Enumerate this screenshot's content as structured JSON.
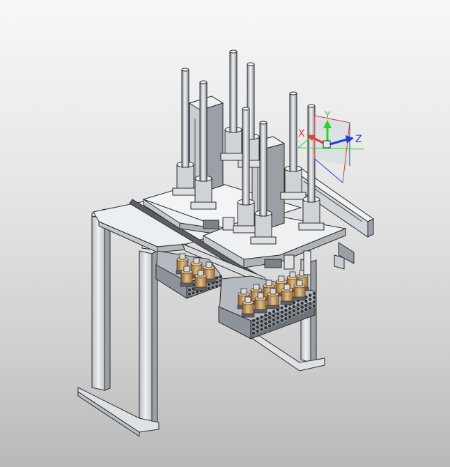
{
  "viewport": {
    "background_top": "#f7f7f7",
    "background_bottom": "#b9b9b9"
  },
  "triad": {
    "x_label": "X",
    "y_label": "Y",
    "z_label": "Z",
    "x_color": "#e53935",
    "y_color": "#2bd22b",
    "z_color": "#1f3fd1",
    "plane_fill": "#cfd8dc"
  },
  "model": {
    "metal_light": "#e9ecef",
    "metal_mid": "#c7cbd0",
    "metal_dark": "#8d939a",
    "edge": "#2b2b2b",
    "bronze": "#c9a06a",
    "bronze_dark": "#8a6334",
    "tray_dark": "#6e737a"
  }
}
